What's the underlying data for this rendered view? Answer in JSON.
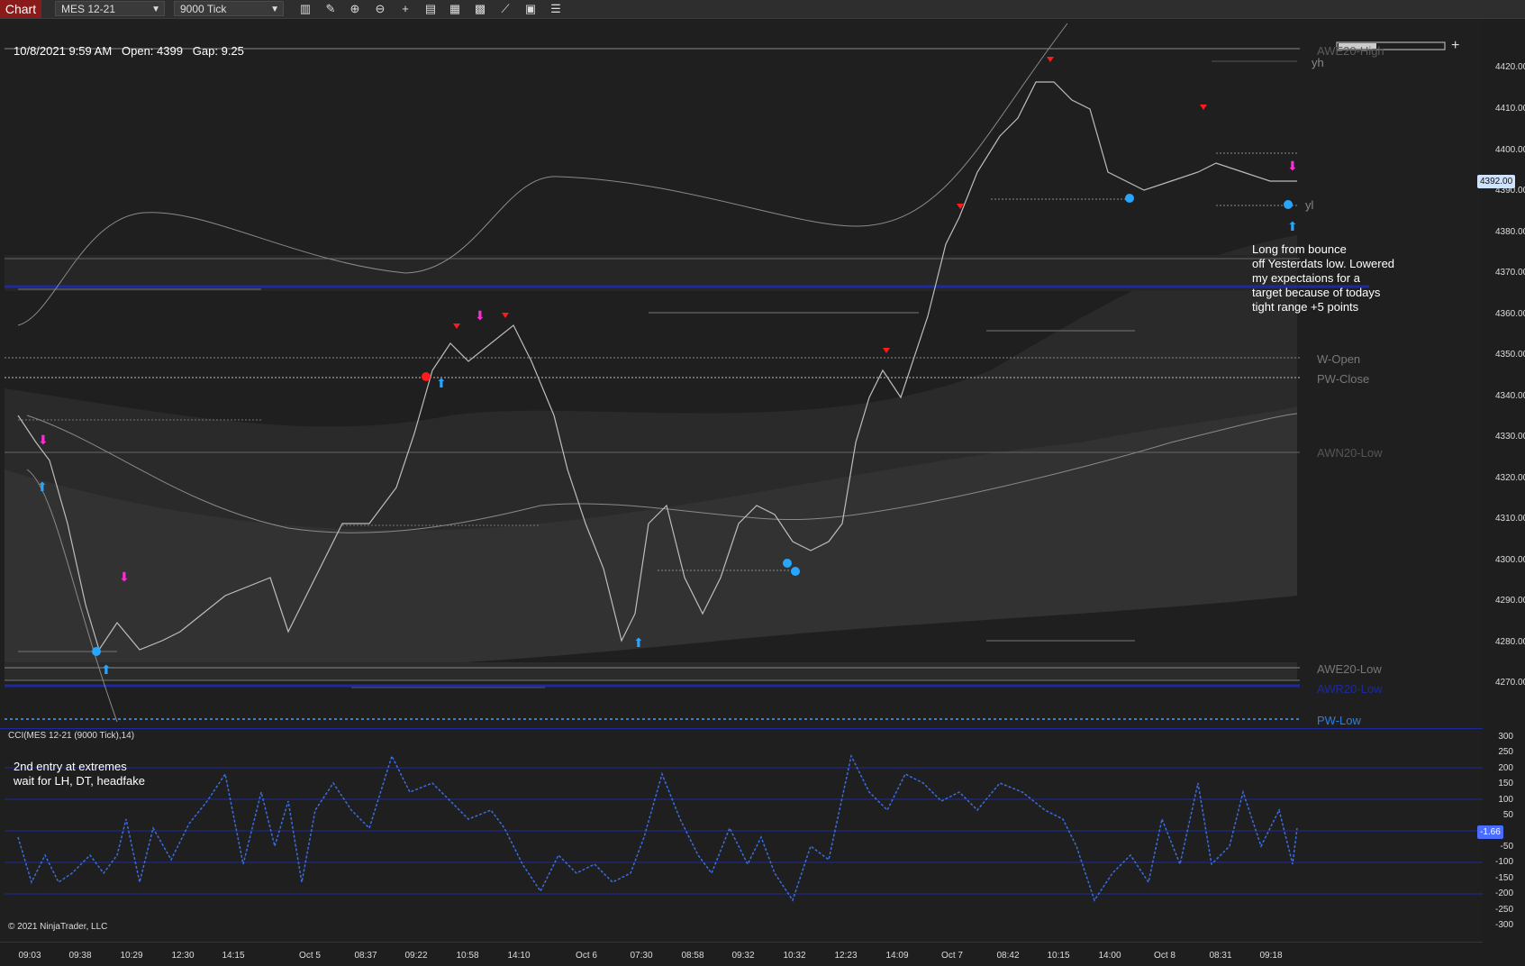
{
  "toolbar": {
    "tab_label": "Chart",
    "instrument": "MES 12-21",
    "interval": "9000 Tick",
    "tools": [
      "bar-type-icon",
      "pencil-icon",
      "zoom-in-icon",
      "zoom-out-icon",
      "crosshair-icon",
      "properties-icon",
      "strategies-icon",
      "indicators-icon",
      "drawing-tools-icon",
      "templates-icon",
      "list-icon"
    ]
  },
  "info_bar": {
    "datetime": "10/8/2021 9:59 AM",
    "open": "Open: 4399",
    "gap": "Gap: 9.25"
  },
  "price_axis": {
    "labels": [
      "4420.00",
      "4410.00",
      "4400.00",
      "4390.00",
      "4380.00",
      "4370.00",
      "4360.00",
      "4350.00",
      "4340.00",
      "4330.00",
      "4320.00",
      "4310.00",
      "4300.00",
      "4290.00",
      "4280.00",
      "4270.00"
    ],
    "current_price": "4392.00"
  },
  "levels": {
    "awe20_high": "AWE20-High",
    "yh": "yh",
    "yl": "yl",
    "w_open": "W-Open",
    "pw_close": "PW-Close",
    "awn20_low": "AWN20-Low",
    "awe20_low": "AWE20-Low",
    "awr20_low": "AWR20-Low",
    "pw_low": "PW-Low"
  },
  "annotations": {
    "trade_note": [
      "Long from bounce",
      "off Yesterdats low. Lowered",
      "my expectaions for a",
      "target because of todays",
      "tight range +5 points"
    ],
    "cci_note": [
      "2nd entry at extremes",
      "wait for LH, DT, headfake"
    ]
  },
  "cci": {
    "title": "CCI(MES 12-21 (9000 Tick),14)",
    "axis_labels": [
      "300",
      "250",
      "200",
      "150",
      "100",
      "50",
      "-50",
      "-100",
      "-150",
      "-200",
      "-250",
      "-300"
    ],
    "current_value": "-1.66"
  },
  "time_axis": {
    "labels": [
      "09:03",
      "09:38",
      "10:29",
      "12:30",
      "14:15",
      "Oct 5",
      "08:37",
      "09:22",
      "10:58",
      "14:10",
      "Oct 6",
      "07:30",
      "08:58",
      "09:32",
      "10:32",
      "12:23",
      "14:09",
      "Oct 7",
      "08:42",
      "10:15",
      "14:00",
      "Oct 8",
      "08:31",
      "09:18"
    ]
  },
  "copyright": "© 2021 NinjaTrader, LLC",
  "colors": {
    "accent_tab": "#8b1a1a",
    "line_blue": "#1c2a9e",
    "cci_line": "#3a6de0",
    "price_bar": "#bdbdbd",
    "marker_magenta": "#ff2bd6",
    "marker_cyan": "#27a6ff",
    "marker_red": "#ff1b1b"
  }
}
